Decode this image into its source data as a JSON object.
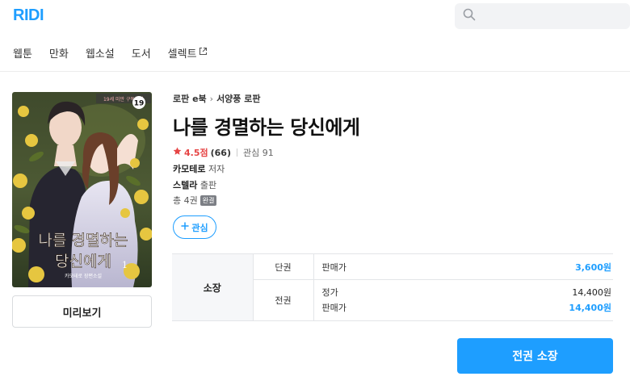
{
  "header": {
    "logo": "RIDI",
    "search": {
      "placeholder": "",
      "icon": "search-icon"
    },
    "nav": [
      {
        "label": "웹툰"
      },
      {
        "label": "만화"
      },
      {
        "label": "웹소설"
      },
      {
        "label": "도서"
      },
      {
        "label": "셀렉트",
        "icon": "external-link-icon"
      }
    ]
  },
  "book": {
    "cover": {
      "age_badge": "19",
      "top_banner": "19세 미만 구독불가",
      "title_lines": [
        "나를 경멸하는",
        "당신에게"
      ],
      "volume": "1",
      "author_on_cover": "카모테로 장편소설"
    },
    "preview_label": "미리보기",
    "breadcrumb": [
      "로판 e북",
      "서양풍 로판"
    ],
    "title": "나를 경멸하는 당신에게",
    "rating": {
      "score": "4.5점",
      "count": "(66)",
      "favorites": "관심 91"
    },
    "author": {
      "name": "카모테로",
      "suffix": "저자"
    },
    "publisher": {
      "name": "스텔라",
      "suffix": "출판"
    },
    "volumes": {
      "text": "총 4권",
      "badge": "완결"
    },
    "fav_button": "관심"
  },
  "price": {
    "own_label": "소장",
    "single": {
      "type": "단권",
      "label": "판매가",
      "value": "3,600원"
    },
    "set": {
      "type": "전권",
      "rows": [
        {
          "label": "정가",
          "value": "14,400원"
        },
        {
          "label": "판매가",
          "value": "14,400원"
        }
      ]
    }
  },
  "buy_button": "전권 소장",
  "colors": {
    "accent": "#1e9eff",
    "rating": "#e64545"
  }
}
